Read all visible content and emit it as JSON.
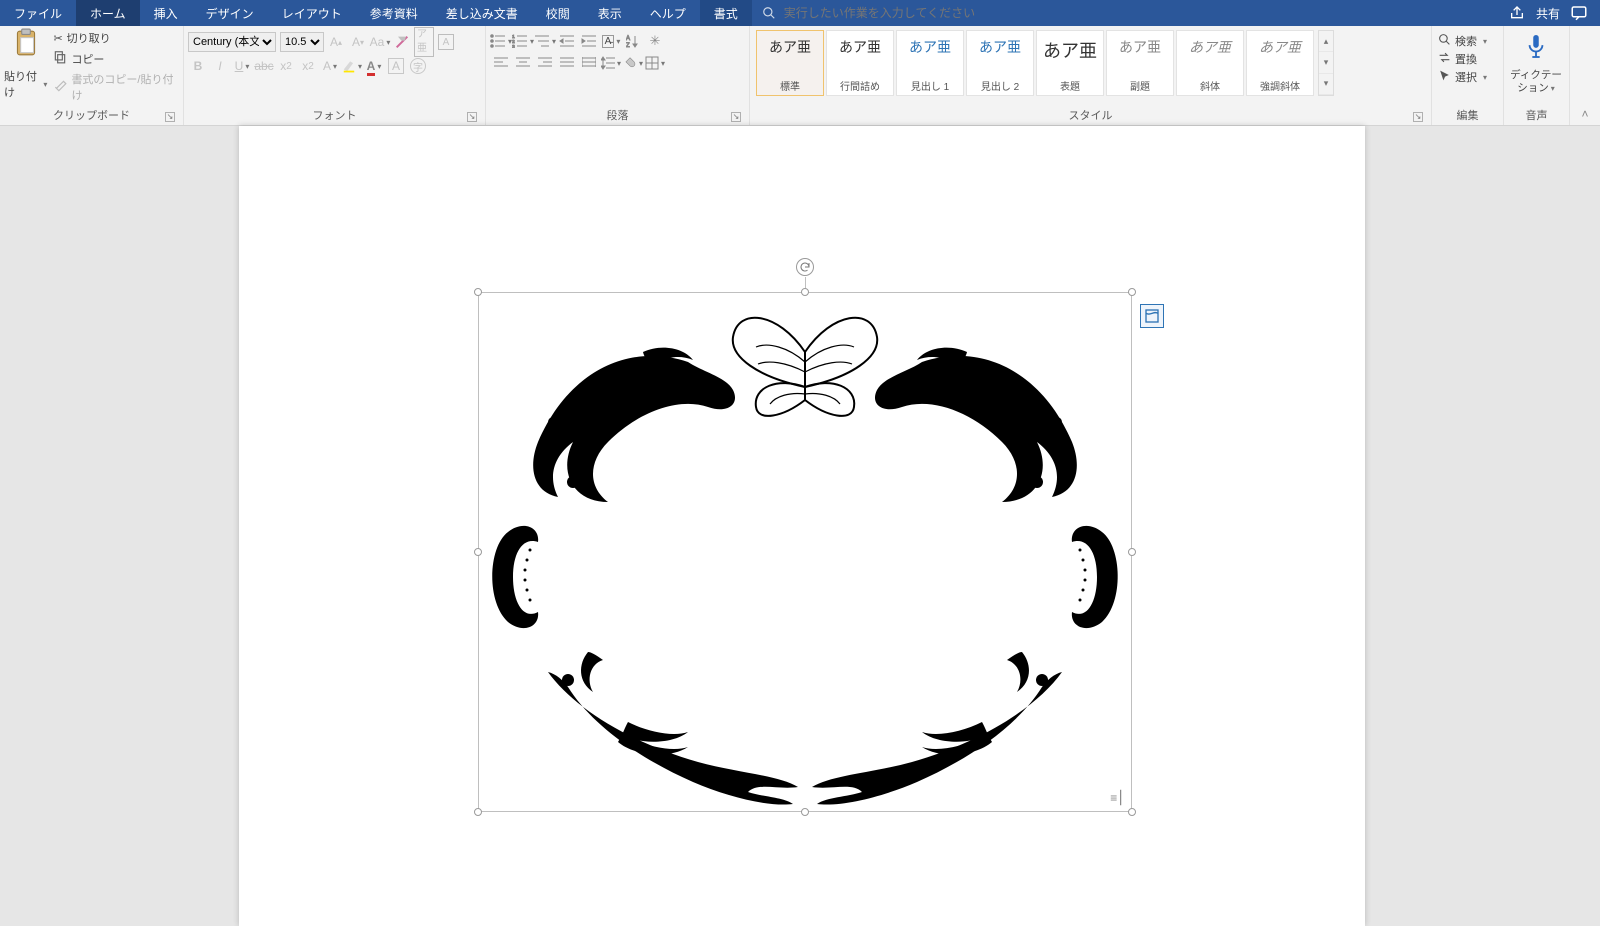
{
  "tabs": {
    "file": "ファイル",
    "home": "ホーム",
    "insert": "挿入",
    "design": "デザイン",
    "layout": "レイアウト",
    "references": "参考資料",
    "mailings": "差し込み文書",
    "review": "校閲",
    "view": "表示",
    "help": "ヘルプ",
    "format": "書式"
  },
  "tellme": {
    "placeholder": "実行したい作業を入力してください"
  },
  "titleright": {
    "share": "共有"
  },
  "clipboard": {
    "paste": "貼り付け",
    "cut": "切り取り",
    "copy": "コピー",
    "formatpainter": "書式のコピー/貼り付け",
    "group": "クリップボード"
  },
  "font": {
    "name": "Century (本文",
    "size": "10.5",
    "group": "フォント"
  },
  "paragraph": {
    "group": "段落"
  },
  "styles": {
    "group": "スタイル",
    "sample": "あア亜",
    "items": [
      {
        "label": "標準"
      },
      {
        "label": "行間詰め"
      },
      {
        "label": "見出し 1"
      },
      {
        "label": "見出し 2"
      },
      {
        "label": "表題"
      },
      {
        "label": "副題"
      },
      {
        "label": "斜体"
      },
      {
        "label": "強調斜体"
      }
    ]
  },
  "editing": {
    "find": "検索",
    "replace": "置換",
    "select": "選択",
    "group": "編集"
  },
  "voice": {
    "dictate": "ディクテーション",
    "group": "音声"
  }
}
